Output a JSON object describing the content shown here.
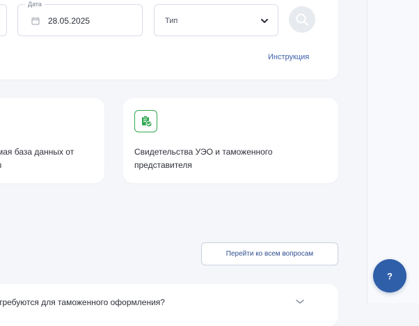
{
  "search": {
    "date_label": "Дата",
    "date_value": "28.05.2025",
    "type_value": "Тип",
    "instruction_link": "Инструкция"
  },
  "services": {
    "left_card_line1": "мая база данных от",
    "left_card_line2": "в",
    "right_card_line1": "Свидетельства УЭО и таможенного",
    "right_card_line2": "представителя"
  },
  "faq": {
    "all_questions_button": "Перейти ко всем вопросам",
    "first_question": "ы требуются для таможенного оформления?"
  },
  "help": {
    "button_label": "?"
  },
  "colors": {
    "accent": "#2f5fa8",
    "link": "#3e5fa8",
    "cert_icon": "#2fa84f"
  },
  "icons": {
    "date": "calendar-icon",
    "type": "chevron-down-icon",
    "search": "search-icon",
    "certificate": "clipboard-check-icon",
    "faq_toggle": "chevron-down-icon"
  }
}
